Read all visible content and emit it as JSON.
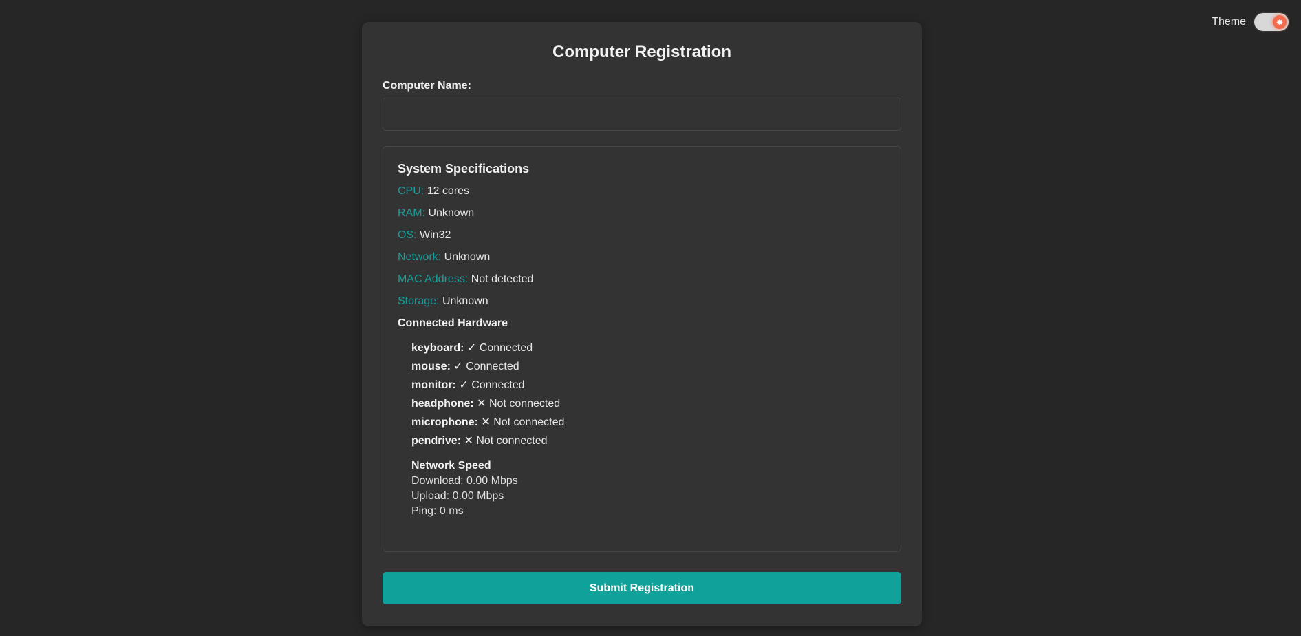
{
  "theme_toggle": {
    "label": "Theme",
    "knob_glyph": "✸",
    "icon": "sun-icon",
    "state": "on",
    "knob_color": "#f26a4b"
  },
  "form": {
    "title": "Computer Registration",
    "computer_name_label": "Computer Name:",
    "computer_name_value": "",
    "computer_name_placeholder": ""
  },
  "specs": {
    "title": "System Specifications",
    "rows": [
      {
        "key": "CPU:",
        "value": "12 cores"
      },
      {
        "key": "RAM:",
        "value": "Unknown"
      },
      {
        "key": "OS:",
        "value": "Win32"
      },
      {
        "key": "Network:",
        "value": "Unknown"
      },
      {
        "key": "MAC Address:",
        "value": "Not detected"
      },
      {
        "key": "Storage:",
        "value": "Unknown"
      }
    ],
    "hardware_title": "Connected Hardware",
    "hardware": [
      {
        "name": "keyboard:",
        "icon": "✓",
        "icon_name": "check-icon",
        "status": "Connected"
      },
      {
        "name": "mouse:",
        "icon": "✓",
        "icon_name": "check-icon",
        "status": "Connected"
      },
      {
        "name": "monitor:",
        "icon": "✓",
        "icon_name": "check-icon",
        "status": "Connected"
      },
      {
        "name": "headphone:",
        "icon": "✕",
        "icon_name": "cross-icon",
        "status": "Not connected"
      },
      {
        "name": "microphone:",
        "icon": "✕",
        "icon_name": "cross-icon",
        "status": "Not connected"
      },
      {
        "name": "pendrive:",
        "icon": "✕",
        "icon_name": "cross-icon",
        "status": "Not connected"
      }
    ],
    "network_speed": {
      "title": "Network Speed",
      "download": "Download: 0.00 Mbps",
      "upload": "Upload: 0.00 Mbps",
      "ping": "Ping: 0 ms"
    }
  },
  "submit_label": "Submit Registration",
  "colors": {
    "background": "#262626",
    "card": "#333333",
    "accent": "#11a19b",
    "spec_key": "#16a19b"
  }
}
